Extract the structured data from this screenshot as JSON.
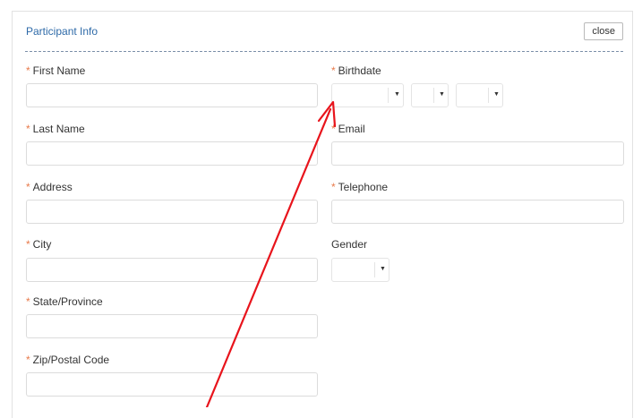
{
  "panel": {
    "title": "Participant Info",
    "close_label": "close"
  },
  "required_mark": "*",
  "fields": {
    "first_name": {
      "label": "First Name",
      "value": ""
    },
    "last_name": {
      "label": "Last Name",
      "value": ""
    },
    "address": {
      "label": "Address",
      "value": ""
    },
    "city": {
      "label": "City",
      "value": ""
    },
    "state": {
      "label": "State/Province",
      "value": ""
    },
    "zip": {
      "label": "Zip/Postal Code",
      "value": ""
    },
    "birthdate": {
      "label": "Birthdate"
    },
    "email": {
      "label": "Email",
      "value": ""
    },
    "telephone": {
      "label": "Telephone",
      "value": ""
    },
    "gender": {
      "label": "Gender"
    }
  },
  "icons": {
    "dropdown": "caret-down-icon",
    "arrow": "red-arrow-annotation"
  },
  "colors": {
    "required": "#e87a4a",
    "title": "#2e6aa8",
    "arrow": "#e8141c"
  }
}
